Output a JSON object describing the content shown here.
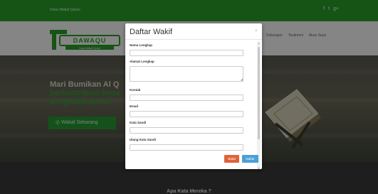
{
  "topbar": {
    "brand": "Dana Wakaf Quran",
    "social": [
      "f",
      "t",
      "g+"
    ]
  },
  "logo": {
    "name": "DAWAQU",
    "tagline": "Dana Wakaf Quran"
  },
  "nav": {
    "links": [
      "Dukungan",
      "Testimoni",
      "Akun Saya"
    ]
  },
  "hero": {
    "title_line1": "Mari Bumikan Al Q",
    "title_line2": "berkontribusi kepa",
    "title_line3": "penghafal quran",
    "cta_label": "Wakaf Sekarang"
  },
  "section2": {
    "heading": "Apa Kata Mereka ?"
  },
  "modal": {
    "title": "Daftar Wakif",
    "close": "×",
    "fields": {
      "nama_label": "Nama Lengkap",
      "alamat_label": "Alamat Lengkap",
      "kontak_label": "Kontak",
      "email_label": "Email",
      "sandi_label": "Kata Sandi",
      "ulang_sandi_label": "Ulang Kata Sandi"
    },
    "cancel_label": "Batal",
    "submit_label": "Daftar"
  },
  "colors": {
    "brand_green": "#2aa12a",
    "cancel": "#e0613a",
    "submit": "#4a9fd8"
  }
}
